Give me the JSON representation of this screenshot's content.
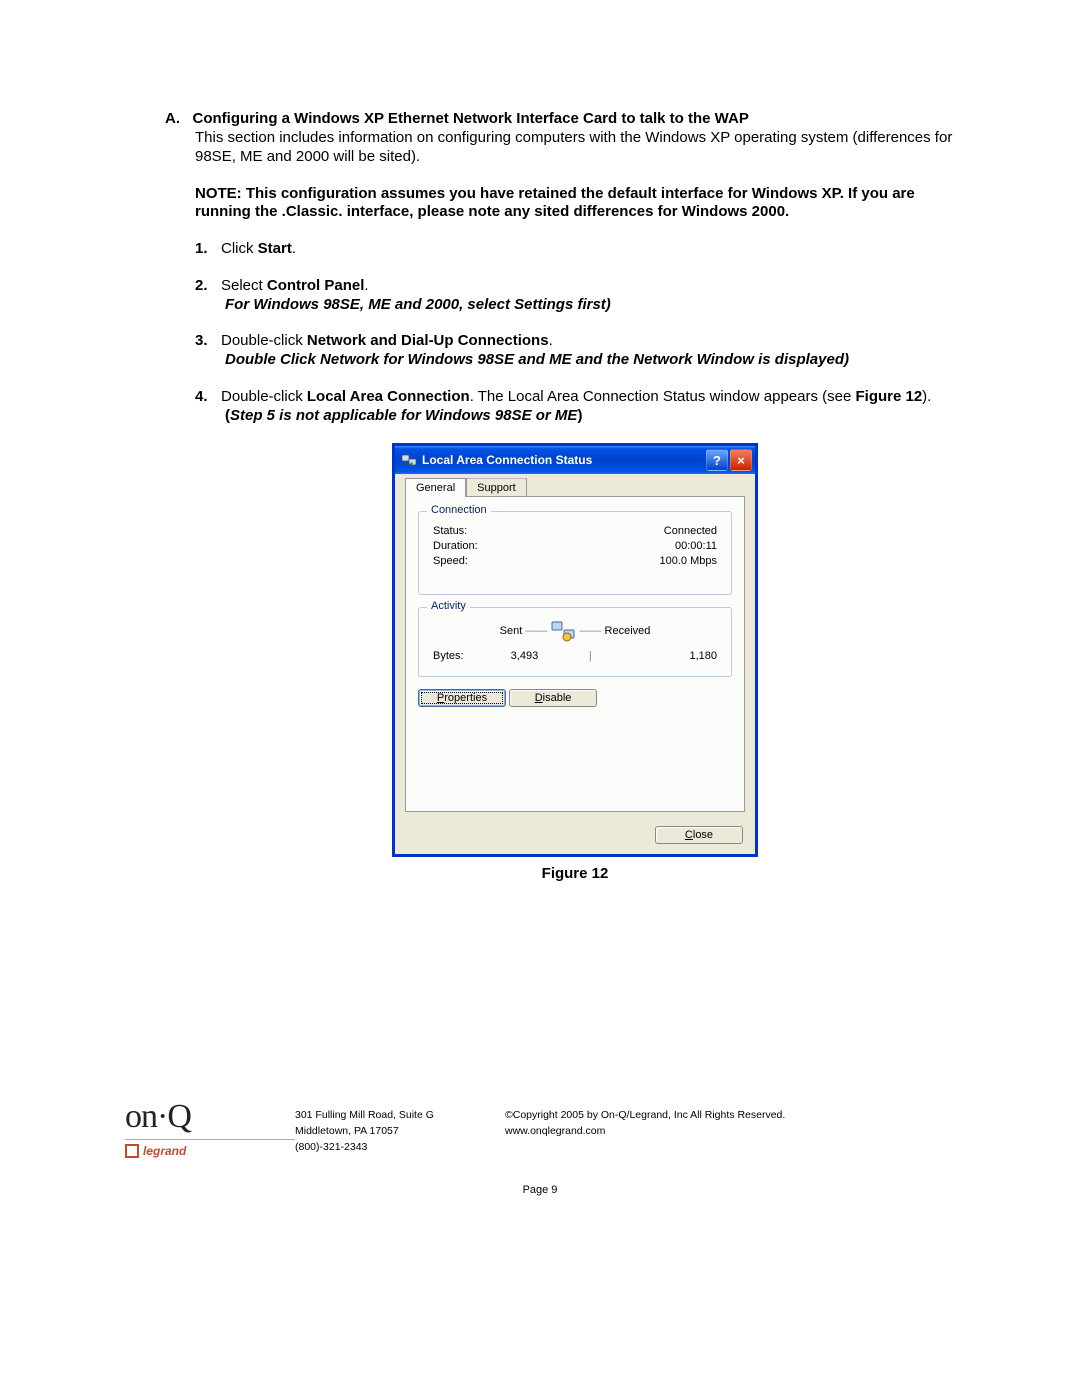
{
  "section": {
    "letter": "A.",
    "heading_title": "Configuring a Windows XP Ethernet Network Interface Card to talk to the WAP",
    "intro": "This section includes information on configuring computers with the Windows XP operating system (differences for 98SE, ME and 2000 will be sited).",
    "note": "NOTE: This configuration assumes you have retained the default interface for Windows XP. If you are running the .Classic. interface, please note any sited differences for Windows 2000."
  },
  "steps": {
    "s1_num": "1.",
    "s1_pre": "Click ",
    "s1_bold": "Start",
    "s1_post": ".",
    "s2_num": "2.",
    "s2_pre": "Select ",
    "s2_bold": "Control Panel",
    "s2_post": ".",
    "s2_note": "For Windows 98SE, ME and 2000, select Settings first)",
    "s3_num": "3.",
    "s3_pre": "Double-click ",
    "s3_bold": "Network and Dial-Up Connections",
    "s3_post": ".",
    "s3_note": "Double Click Network for Windows 98SE and ME and the Network Window is displayed)",
    "s4_num": "4.",
    "s4_pre": "Double-click ",
    "s4_bold": "Local Area Connection",
    "s4_mid": ". The Local Area Connection Status window appears (see ",
    "s4_fig": "Figure 12",
    "s4_post": ").",
    "s4_note_open": "(",
    "s4_note": "Step 5 is not applicable for Windows 98SE or ME",
    "s4_note_close": ")"
  },
  "dialog": {
    "title": "Local Area Connection Status",
    "tabs": {
      "general": "General",
      "support": "Support"
    },
    "groups": {
      "connection": "Connection",
      "activity": "Activity"
    },
    "labels": {
      "status": "Status:",
      "duration": "Duration:",
      "speed": "Speed:",
      "sent": "Sent",
      "received": "Received",
      "bytes": "Bytes:"
    },
    "values": {
      "status": "Connected",
      "duration": "00:00:11",
      "speed": "100.0 Mbps",
      "bytes_sent": "3,493",
      "bytes_received": "1,180"
    },
    "buttons": {
      "properties_u": "P",
      "properties_rest": "roperties",
      "disable_u": "D",
      "disable_rest": "isable",
      "close_u": "C",
      "close_rest": "lose"
    }
  },
  "caption": "Figure 12",
  "footer": {
    "addr1": "301 Fulling Mill Road, Suite G",
    "addr2": "Middletown, PA   17057",
    "phone": "(800)-321-2343",
    "copyright": "©Copyright 2005 by On-Q/Legrand, Inc All Rights Reserved.",
    "url": "www.onqlegrand.com",
    "page": "Page 9",
    "logo_onq": "on·Q",
    "logo_legrand": "legrand"
  }
}
